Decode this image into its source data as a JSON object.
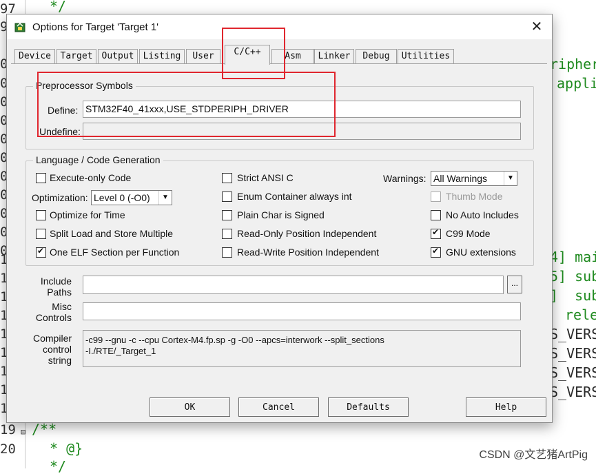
{
  "editor": {
    "line_numbers": [
      "97",
      "9",
      "0",
      "0",
      "0",
      "0",
      "0",
      "0",
      "0",
      "0",
      "0",
      "0",
      "0",
      "1",
      "1",
      "1",
      "1",
      "1",
      "1",
      "1",
      "1",
      "1",
      "1",
      "19",
      "20"
    ],
    "code_left": [
      "*/",
      "/**",
      "* @}",
      "*/"
    ],
    "code_right": [
      "ripher",
      "appli",
      "4] mai",
      "5] sub",
      "]  sub",
      "rele",
      "S_VERS",
      "S_VERS",
      "S_VERS",
      "S_VERS"
    ]
  },
  "watermark": "CSDN @文艺猪ArtPig",
  "dialog": {
    "title": "Options for Target 'Target 1'",
    "close_symbol": "✕",
    "tabs": [
      "Device",
      "Target",
      "Output",
      "Listing",
      "User",
      "C/C++",
      "Asm",
      "Linker",
      "Debug",
      "Utilities"
    ],
    "active_tab": "C/C++",
    "preprocessor": {
      "group_label": "Preprocessor Symbols",
      "define_label": "Define:",
      "define_value": "STM32F40_41xxx,USE_STDPERIPH_DRIVER",
      "undefine_label": "Undefine:",
      "undefine_value": ""
    },
    "language": {
      "group_label": "Language / Code Generation",
      "execute_only": {
        "label": "Execute-only Code",
        "checked": false
      },
      "optimization_label": "Optimization:",
      "optimization_value": "Level 0 (-O0)",
      "optimize_time": {
        "label": "Optimize for Time",
        "checked": false
      },
      "split_load": {
        "label": "Split Load and Store Multiple",
        "checked": false
      },
      "one_elf": {
        "label": "One ELF Section per Function",
        "checked": true
      },
      "strict_ansi": {
        "label": "Strict ANSI C",
        "checked": false
      },
      "enum_int": {
        "label": "Enum Container always int",
        "checked": false
      },
      "plain_char": {
        "label": "Plain Char is Signed",
        "checked": false
      },
      "ro_pi": {
        "label": "Read-Only Position Independent",
        "checked": false
      },
      "rw_pi": {
        "label": "Read-Write Position Independent",
        "checked": false
      },
      "warnings_label": "Warnings:",
      "warnings_value": "All Warnings",
      "thumb_mode": {
        "label": "Thumb Mode",
        "checked": false,
        "disabled": true
      },
      "no_auto_includes": {
        "label": "No Auto Includes",
        "checked": false
      },
      "c99_mode": {
        "label": "C99 Mode",
        "checked": true
      },
      "gnu_ext": {
        "label": "GNU extensions",
        "checked": true
      }
    },
    "include_paths_label": "Include\nPaths",
    "include_paths_value": "",
    "include_browse": "...",
    "misc_controls_label": "Misc\nControls",
    "misc_controls_value": "",
    "compiler_string_label": "Compiler\ncontrol\nstring",
    "compiler_string_value": "-c99 --gnu -c --cpu Cortex-M4.fp.sp -g -O0 --apcs=interwork --split_sections\n-I./RTE/_Target_1",
    "buttons": {
      "ok": "OK",
      "cancel": "Cancel",
      "defaults": "Defaults",
      "help": "Help"
    }
  }
}
